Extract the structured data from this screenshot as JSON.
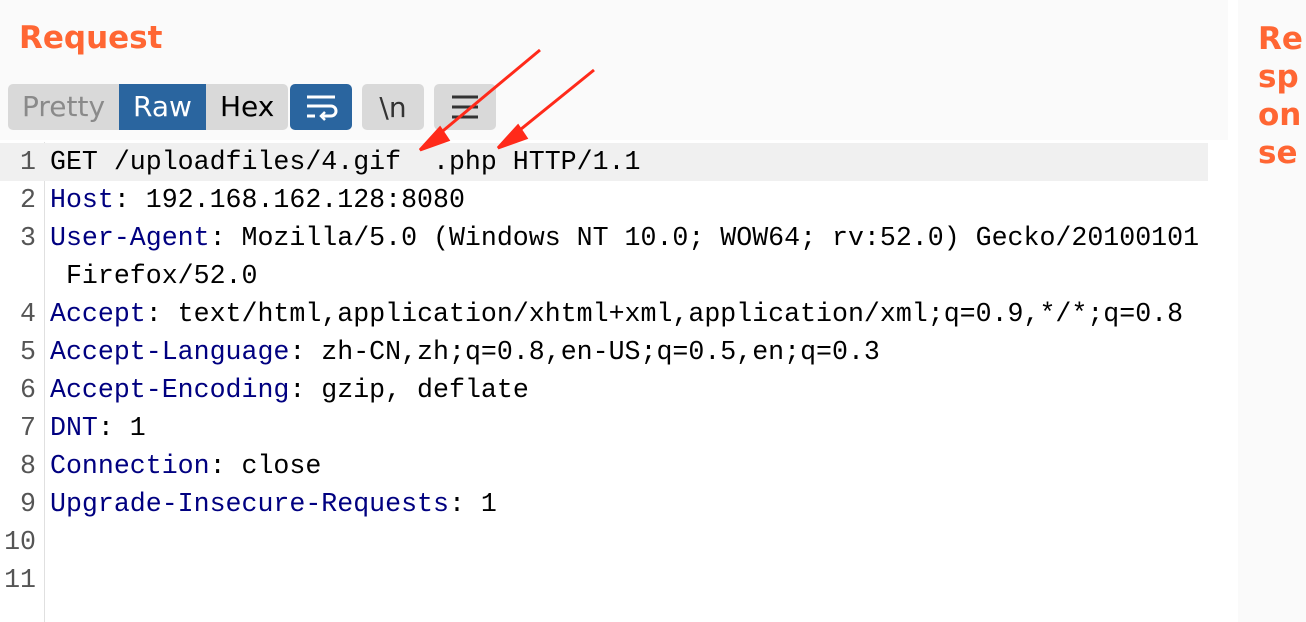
{
  "request": {
    "title": "Request",
    "view_tabs": [
      {
        "label": "Pretty",
        "active": false
      },
      {
        "label": "Raw",
        "active": true
      },
      {
        "label": "Hex",
        "active": false
      }
    ],
    "newline_label": "\\n",
    "lines": [
      {
        "n": "1",
        "key": "",
        "text": "GET /uploadfiles/4.gif  .php HTTP/1.1"
      },
      {
        "n": "2",
        "key": "Host",
        "text": ": 192.168.162.128:8080"
      },
      {
        "n": "3",
        "key": "User-Agent",
        "text": ": Mozilla/5.0 (Windows NT 10.0; WOW64; rv:52.0) Gecko/20100101",
        "cont": " Firefox/52.0"
      },
      {
        "n": "4",
        "key": "Accept",
        "text": ": text/html,application/xhtml+xml,application/xml;q=0.9,*/*;q=0.8"
      },
      {
        "n": "5",
        "key": "Accept-Language",
        "text": ": zh-CN,zh;q=0.8,en-US;q=0.5,en;q=0.3"
      },
      {
        "n": "6",
        "key": "Accept-Encoding",
        "text": ": gzip, deflate"
      },
      {
        "n": "7",
        "key": "DNT",
        "text": ": 1"
      },
      {
        "n": "8",
        "key": "Connection",
        "text": ": close"
      },
      {
        "n": "9",
        "key": "Upgrade-Insecure-Requests",
        "text": ": 1"
      },
      {
        "n": "10",
        "key": "",
        "text": ""
      },
      {
        "n": "11",
        "key": "",
        "text": ""
      }
    ]
  },
  "response": {
    "title": "Response"
  },
  "colors": {
    "accent": "#ff6633",
    "active_tab": "#2a659f",
    "header_key": "#000080",
    "arrow": "#ff2a1a"
  }
}
